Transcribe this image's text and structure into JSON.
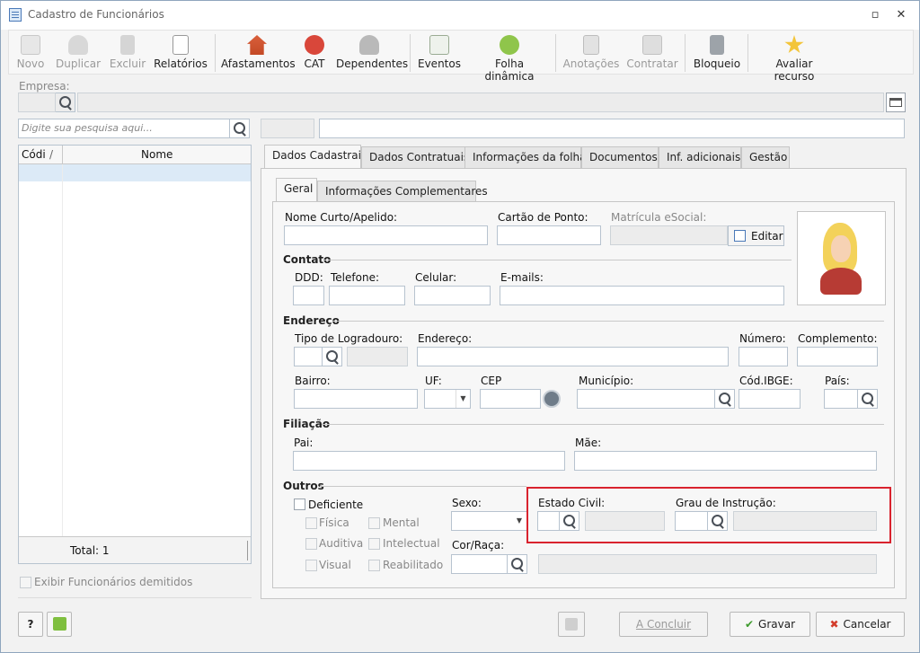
{
  "window": {
    "title": "Cadastro de Funcionários"
  },
  "toolbar": {
    "novo": "Novo",
    "duplicar": "Duplicar",
    "excluir": "Excluir",
    "relatorios": "Relatórios",
    "afastamentos": "Afastamentos",
    "cat": "CAT",
    "dependentes": "Dependentes",
    "eventos": "Eventos",
    "folha_dinamica": "Folha dinâmica",
    "anotacoes": "Anotações",
    "contratar": "Contratar",
    "bloqueio": "Bloqueio",
    "avaliar": "Avaliar recurso"
  },
  "empresa": {
    "label": "Empresa:"
  },
  "search": {
    "placeholder": "Digite sua pesquisa aqui..."
  },
  "list": {
    "col_codigo": "Códi",
    "col_nome": "Nome",
    "total": "Total: 1",
    "exibir_demitidos": "Exibir Funcionários demitidos"
  },
  "tabs": [
    "Dados Cadastrais",
    "Dados Contratuais",
    "Informações da folha",
    "Documentos",
    "Inf. adicionais",
    "Gestão"
  ],
  "subtabs": [
    "Geral",
    "Informações Complementares"
  ],
  "form": {
    "nome_curto": "Nome Curto/Apelido:",
    "cartao_ponto": "Cartão de Ponto:",
    "matricula": "Matrícula eSocial:",
    "editar": "Editar",
    "contato": "Contato",
    "ddd": "DDD:",
    "telefone": "Telefone:",
    "celular": "Celular:",
    "emails": "E-mails:",
    "endereco_sec": "Endereço",
    "tipo_logradouro": "Tipo de Logradouro:",
    "endereco": "Endereço:",
    "numero": "Número:",
    "complemento": "Complemento:",
    "bairro": "Bairro:",
    "uf": "UF:",
    "cep": "CEP",
    "municipio": "Município:",
    "cod_ibge": "Cód.IBGE:",
    "pais": "País:",
    "filiacao": "Filiação",
    "pai": "Pai:",
    "mae": "Mãe:",
    "outros": "Outros",
    "deficiente": "Deficiente",
    "fisica": "Física",
    "mental": "Mental",
    "auditiva": "Auditiva",
    "intelectual": "Intelectual",
    "visual": "Visual",
    "reabilitado": "Reabilitado",
    "sexo": "Sexo:",
    "cor_raca": "Cor/Raça:",
    "estado_civil": "Estado Civil:",
    "grau_instrucao": "Grau de Instrução:"
  },
  "footer": {
    "concluir": "A Concluir",
    "gravar": "Gravar",
    "cancelar": "Cancelar"
  }
}
